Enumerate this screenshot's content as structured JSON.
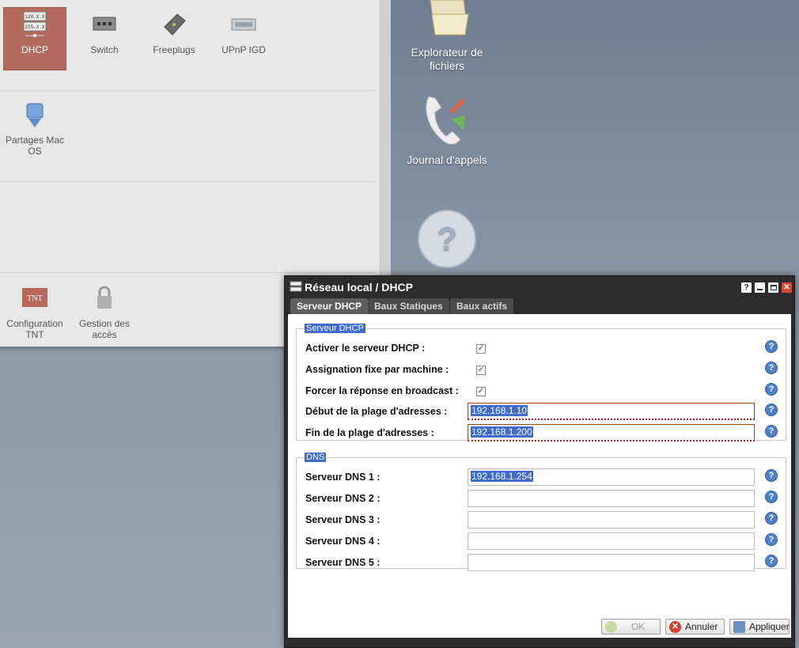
{
  "settings": {
    "row1": [
      {
        "label": "DHCP",
        "icon": "dhcp-server-icon",
        "active": true
      },
      {
        "label": "Switch",
        "icon": "switch-icon",
        "active": false
      },
      {
        "label": "Freeplugs",
        "icon": "freeplug-icon",
        "active": false
      },
      {
        "label": "UPnP IGD",
        "icon": "upnp-device-icon",
        "active": false
      }
    ],
    "row2": [
      {
        "label": "Partages Mac OS",
        "icon": "mac-share-icon"
      }
    ],
    "row4": [
      {
        "label": "Configuration TNT",
        "icon": "tnt-icon",
        "icon_text": "TNT"
      },
      {
        "label": "Gestion des accès",
        "icon": "padlock-icon"
      }
    ]
  },
  "desktop": [
    {
      "label": "Explorateur de fichiers",
      "icon": "folder-icon"
    },
    {
      "label": "Journal d'appels",
      "icon": "call-log-icon"
    },
    {
      "label": "",
      "icon": "help-icon"
    }
  ],
  "window": {
    "title": "Réseau local / DHCP",
    "controls": {
      "help": "?",
      "close": "✕"
    },
    "tabs": [
      {
        "label": "Serveur DHCP",
        "active": true
      },
      {
        "label": "Baux Statiques",
        "active": false
      },
      {
        "label": "Baux actifs",
        "active": false
      }
    ],
    "dhcp_section": {
      "legend": "Serveur DHCP",
      "enable_label": "Activer le serveur DHCP :",
      "enable_checked": true,
      "fixed_label": "Assignation fixe par machine :",
      "fixed_checked": true,
      "broadcast_label": "Forcer la réponse en broadcast :",
      "broadcast_checked": true,
      "range_start_label": "Début de la plage d'adresses :",
      "range_start_value": "192.168.1.10",
      "range_end_label": "Fin de la plage d'adresses :",
      "range_end_value": "192.168.1.200"
    },
    "dns_section": {
      "legend": "DNS",
      "servers": [
        {
          "label": "Serveur DNS 1 :",
          "value": "192.168.1.254"
        },
        {
          "label": "Serveur DNS 2 :",
          "value": ""
        },
        {
          "label": "Serveur DNS 3 :",
          "value": ""
        },
        {
          "label": "Serveur DNS 4 :",
          "value": ""
        },
        {
          "label": "Serveur DNS 5 :",
          "value": ""
        }
      ]
    },
    "buttons": {
      "ok": "OK",
      "cancel": "Annuler",
      "apply": "Appliquer"
    },
    "help_glyph": "?",
    "check_glyph": "✓"
  },
  "colors": {
    "active_tile": "#b46b5e",
    "selection": "#3f6ccd",
    "help_icon": "#4f7fc9"
  }
}
